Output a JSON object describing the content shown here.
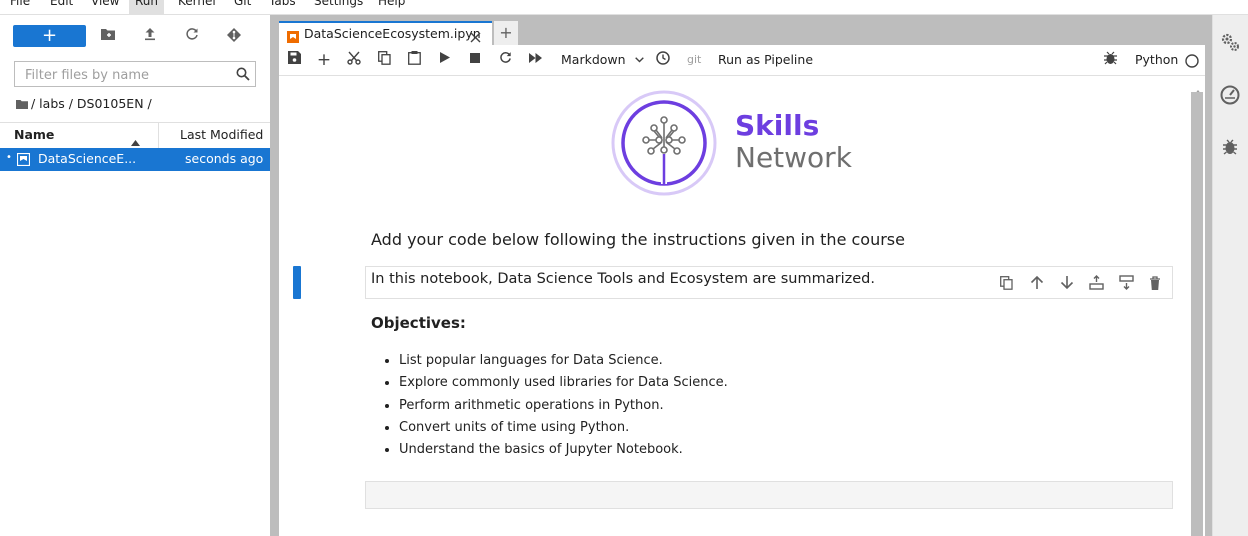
{
  "menubar": {
    "items": [
      {
        "label": "File"
      },
      {
        "label": "Edit"
      },
      {
        "label": "View"
      },
      {
        "label": "Run"
      },
      {
        "label": "Kernel"
      },
      {
        "label": "Git"
      },
      {
        "label": "Tabs"
      },
      {
        "label": "Settings"
      },
      {
        "label": "Help"
      }
    ],
    "active": "Run"
  },
  "file_browser": {
    "new_button_label": "+",
    "filter_placeholder": "Filter files by name",
    "breadcrumb": "/ labs / DS0105EN /",
    "columns": {
      "name": "Name",
      "modified": "Last Modified"
    },
    "files": [
      {
        "name": "DataScienceE...",
        "modified": "seconds ago",
        "selected": true
      }
    ]
  },
  "tabs": [
    {
      "label": "DataScienceEcosystem.ipyn",
      "active": true
    }
  ],
  "notebook_toolbar": {
    "cell_type": "Markdown",
    "git_label": "git",
    "pipeline_label": "Run as Pipeline",
    "kernel_name": "Python"
  },
  "notebook": {
    "logo": {
      "line1": "Skills",
      "line2": "Network"
    },
    "heading": "Add your code below following the instructions given in the course",
    "active_cell_text": "In this notebook, Data Science Tools and Ecosystem are summarized.",
    "objectives_title": "Objectives:",
    "objectives": [
      "List popular languages for Data Science.",
      "Explore commonly used libraries for Data Science.",
      "Perform arithmetic operations in Python.",
      "Convert units of time using Python.",
      "Understand the basics of Jupyter Notebook."
    ]
  },
  "colors": {
    "accent": "#1976d2",
    "logo_purple": "#6d3ee0",
    "logo_gray": "#6f6f6f"
  }
}
